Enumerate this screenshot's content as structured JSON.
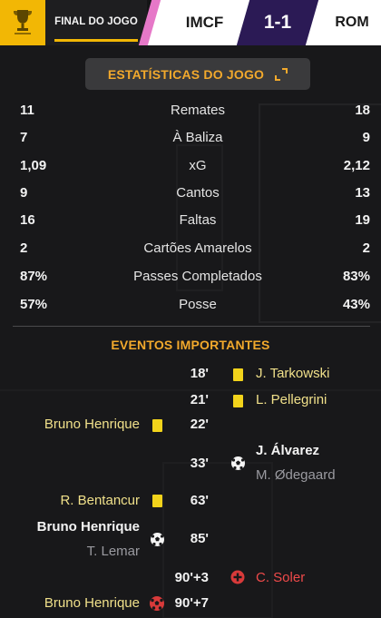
{
  "header": {
    "status": "FINAL DO JOGO",
    "home_team": "IMCF",
    "score": "1-1",
    "away_team": "ROM",
    "colors": {
      "accent": "#f2b705",
      "score_bg": "#2b1a55",
      "pink": "#e678c8"
    }
  },
  "stats": {
    "title": "ESTATÍSTICAS DO JOGO",
    "rows": [
      {
        "home": "11",
        "label": "Remates",
        "away": "18"
      },
      {
        "home": "7",
        "label": "À Baliza",
        "away": "9"
      },
      {
        "home": "1,09",
        "label": "xG",
        "away": "2,12"
      },
      {
        "home": "9",
        "label": "Cantos",
        "away": "13"
      },
      {
        "home": "16",
        "label": "Faltas",
        "away": "19"
      },
      {
        "home": "2",
        "label": "Cartões Amarelos",
        "away": "2"
      },
      {
        "home": "87%",
        "label": "Passes Completados",
        "away": "83%"
      },
      {
        "home": "57%",
        "label": "Posse",
        "away": "43%"
      }
    ]
  },
  "events": {
    "title": "EVENTOS IMPORTANTES",
    "list": [
      {
        "minute": "18'",
        "icon": "yellow-card-icon",
        "side": "away",
        "player": "J. Tarkowski"
      },
      {
        "minute": "21'",
        "icon": "yellow-card-icon",
        "side": "away",
        "player": "L. Pellegrini"
      },
      {
        "minute": "22'",
        "icon": "yellow-card-icon",
        "side": "home",
        "player": "Bruno Henrique"
      },
      {
        "minute": "33'",
        "icon": "goal-ball-icon",
        "side": "away",
        "player": "J. Álvarez",
        "assist": "M. Ødegaard"
      },
      {
        "minute": "63'",
        "icon": "yellow-card-icon",
        "side": "home",
        "player": "R. Bentancur"
      },
      {
        "minute": "85'",
        "icon": "goal-ball-icon",
        "side": "home",
        "player": "Bruno Henrique",
        "assist": "T. Lemar"
      },
      {
        "minute": "90'+3",
        "icon": "injury-cross-icon",
        "side": "away",
        "player": "C. Soler"
      },
      {
        "minute": "90'+7",
        "icon": "injury-ball-icon",
        "side": "home",
        "player": "Bruno Henrique"
      }
    ]
  }
}
